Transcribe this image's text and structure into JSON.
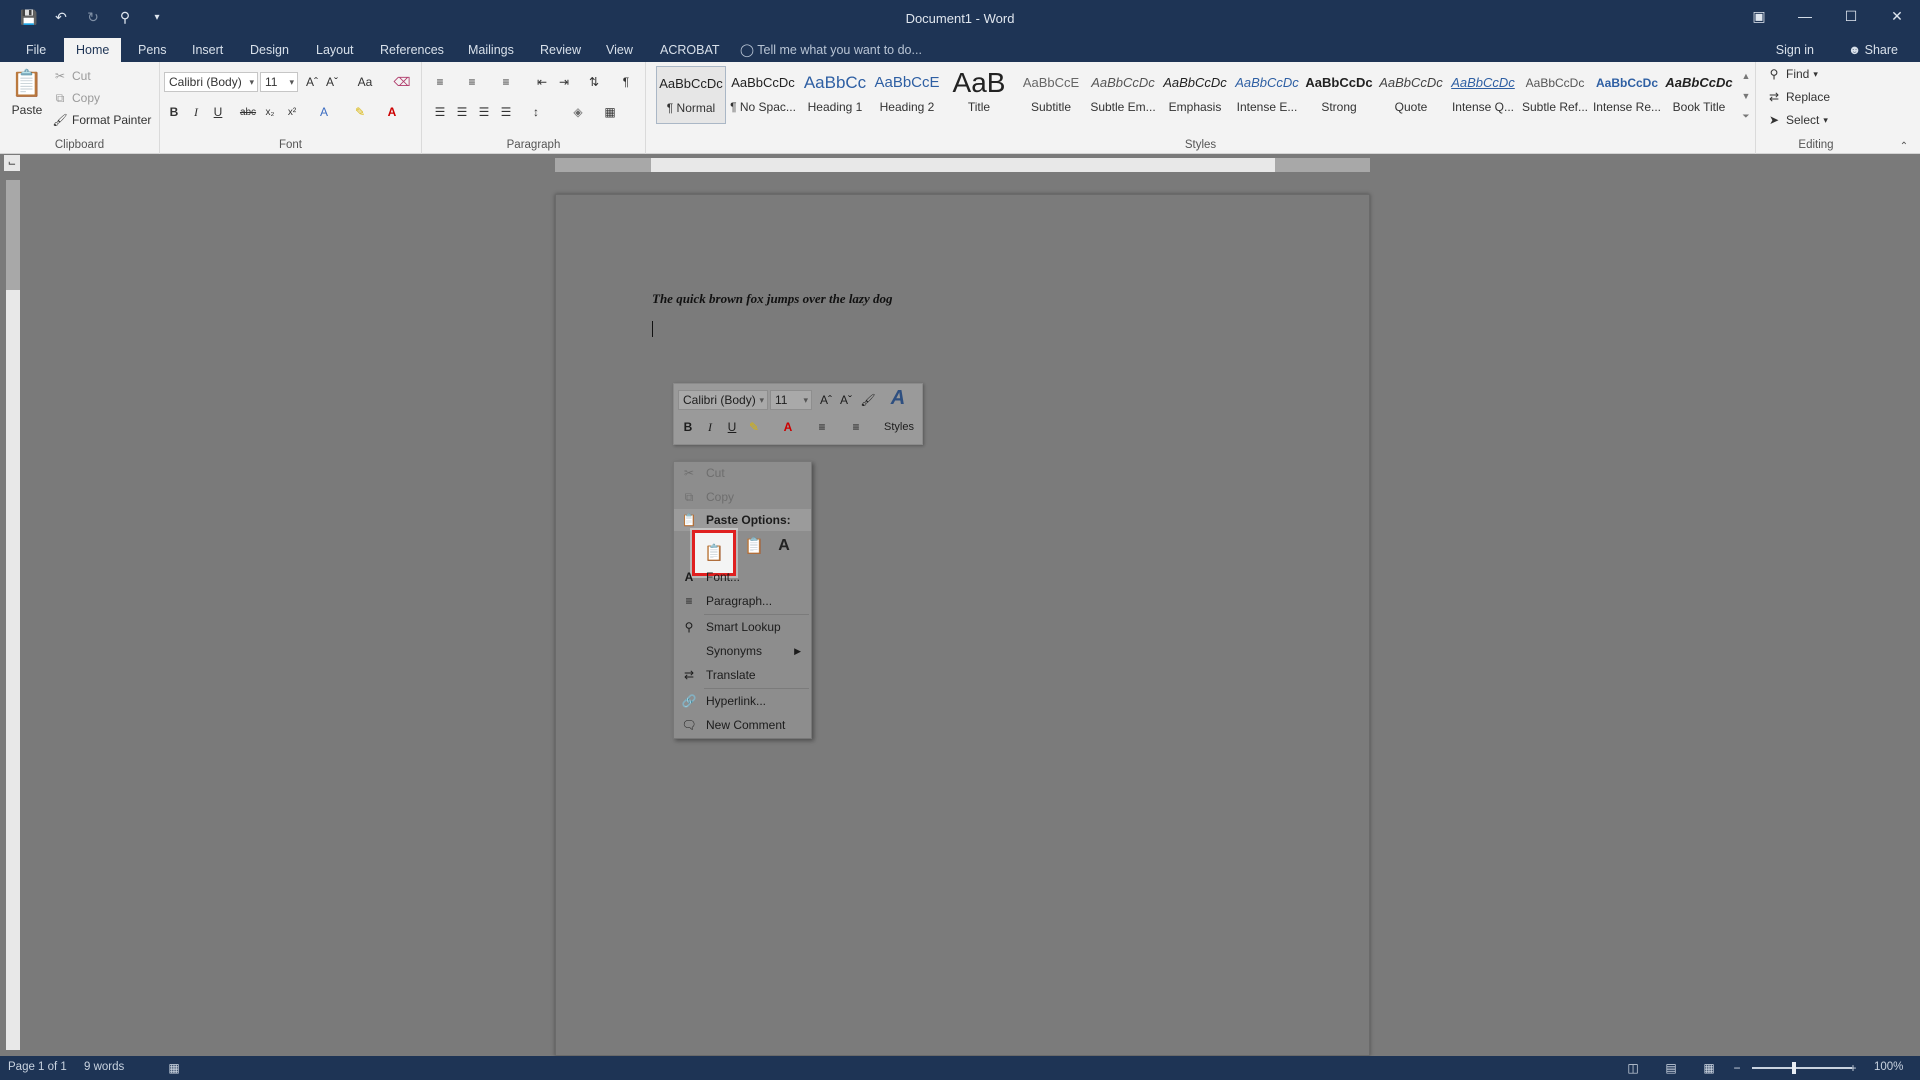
{
  "window": {
    "title": "Document1 - Word",
    "qat_icons": [
      "save-icon",
      "undo-icon",
      "redo-icon",
      "touch-mode-icon",
      "customize-qat-icon"
    ]
  },
  "tabs": [
    "File",
    "Home",
    "Pens",
    "Insert",
    "Design",
    "Layout",
    "References",
    "Mailings",
    "Review",
    "View",
    "ACROBAT"
  ],
  "active_tab": "Home",
  "tell_me": "Tell me what you want to do...",
  "sign_in": "Sign in",
  "share": "Share",
  "ribbon": {
    "clipboard": {
      "paste": "Paste",
      "cut": "Cut",
      "copy": "Copy",
      "format_painter": "Format Painter",
      "label": "Clipboard"
    },
    "font": {
      "name": "Calibri (Body)",
      "size": "11",
      "label": "Font",
      "change_case": "Aa"
    },
    "paragraph": {
      "label": "Paragraph"
    },
    "styles": {
      "label": "Styles",
      "items": [
        {
          "sample": "AaBbCcDc",
          "name": "¶ Normal"
        },
        {
          "sample": "AaBbCcDc",
          "name": "¶ No Spac..."
        },
        {
          "sample": "AaBbCc",
          "name": "Heading 1"
        },
        {
          "sample": "AaBbCcE",
          "name": "Heading 2"
        },
        {
          "sample": "AaB",
          "name": "Title"
        },
        {
          "sample": "AaBbCcE",
          "name": "Subtitle"
        },
        {
          "sample": "AaBbCcDc",
          "name": "Subtle Em..."
        },
        {
          "sample": "AaBbCcDc",
          "name": "Emphasis"
        },
        {
          "sample": "AaBbCcDc",
          "name": "Intense E..."
        },
        {
          "sample": "AaBbCcDc",
          "name": "Strong"
        },
        {
          "sample": "AaBbCcDc",
          "name": "Quote"
        },
        {
          "sample": "AaBbCcDc",
          "name": "Intense Q..."
        },
        {
          "sample": "AaBbCcDc",
          "name": "Subtle Ref..."
        },
        {
          "sample": "AaBbCcDc",
          "name": "Intense Re..."
        },
        {
          "sample": "AaBbCcDc",
          "name": "Book Title"
        }
      ]
    },
    "editing": {
      "find": "Find",
      "replace": "Replace",
      "select": "Select",
      "label": "Editing"
    }
  },
  "document": {
    "text": "The quick brown fox jumps over the lazy dog"
  },
  "mini_toolbar": {
    "font": "Calibri (Body)",
    "size": "11",
    "styles": "Styles"
  },
  "context_menu": {
    "cut": "Cut",
    "copy": "Copy",
    "paste_options": "Paste Options:",
    "font": "Font...",
    "paragraph": "Paragraph...",
    "smart_lookup": "Smart Lookup",
    "synonyms": "Synonyms",
    "translate": "Translate",
    "hyperlink": "Hyperlink...",
    "new_comment": "New Comment"
  },
  "status": {
    "page": "Page 1 of 1",
    "words": "9 words",
    "zoom": "100%"
  },
  "colors": {
    "title_bar": "#1e3455",
    "ribbon_bg": "#f3f3f3",
    "highlight": "#e02020"
  }
}
